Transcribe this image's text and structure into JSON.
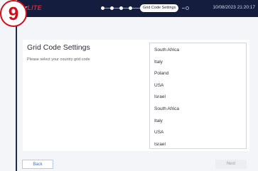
{
  "step_badge": "9",
  "header": {
    "logo_prefix": "ar",
    "logo_text": "LITE",
    "current_step": "Grid Code Settings",
    "datetime": "10/08/2023 21:20:17"
  },
  "main": {
    "title": "Grid Code Settings",
    "subtitle": "Please select your country grid code",
    "countries": [
      "South Africa",
      "Italy",
      "Poland",
      "USA",
      "Israel",
      "South Africa",
      "Italy",
      "USA",
      "Israel"
    ]
  },
  "footer": {
    "back_label": "Back",
    "next_label": "Next"
  },
  "colors": {
    "header_bg": "#141d3d",
    "badge_red": "#d10f1a",
    "back_blue": "#3f73c4"
  }
}
